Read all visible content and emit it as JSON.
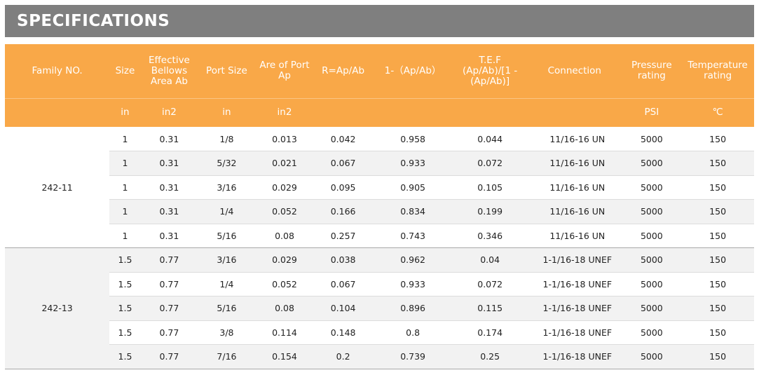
{
  "title": "SPECIFICATIONS",
  "headers": [
    "Family NO.",
    "Size",
    "Effective Bellows Area Ab",
    "Port Size",
    "Are of Port Ap",
    "R=Ap/Ab",
    "1-（Ap/Ab）",
    "T.E.F (Ap/Ab)/[1 -(Ap/Ab)]",
    "Connection",
    "Pressure rating",
    "Temperature rating"
  ],
  "units": [
    "",
    "in",
    "in2",
    "in",
    "in2",
    "",
    "",
    "",
    "",
    "PSI",
    "℃"
  ],
  "groups": [
    {
      "family": "242-11",
      "rows": [
        [
          "1",
          "0.31",
          "1/8",
          "0.013",
          "0.042",
          "0.958",
          "0.044",
          "11/16-16 UN",
          "5000",
          "150"
        ],
        [
          "1",
          "0.31",
          "5/32",
          "0.021",
          "0.067",
          "0.933",
          "0.072",
          "11/16-16 UN",
          "5000",
          "150"
        ],
        [
          "1",
          "0.31",
          "3/16",
          "0.029",
          "0.095",
          "0.905",
          "0.105",
          "11/16-16 UN",
          "5000",
          "150"
        ],
        [
          "1",
          "0.31",
          "1/4",
          "0.052",
          "0.166",
          "0.834",
          "0.199",
          "11/16-16 UN",
          "5000",
          "150"
        ],
        [
          "1",
          "0.31",
          "5/16",
          "0.08",
          "0.257",
          "0.743",
          "0.346",
          "11/16-16 UN",
          "5000",
          "150"
        ]
      ]
    },
    {
      "family": "242-13",
      "rows": [
        [
          "1.5",
          "0.77",
          "3/16",
          "0.029",
          "0.038",
          "0.962",
          "0.04",
          "1-1/16-18 UNEF",
          "5000",
          "150"
        ],
        [
          "1.5",
          "0.77",
          "1/4",
          "0.052",
          "0.067",
          "0.933",
          "0.072",
          "1-1/16-18 UNEF",
          "5000",
          "150"
        ],
        [
          "1.5",
          "0.77",
          "5/16",
          "0.08",
          "0.104",
          "0.896",
          "0.115",
          "1-1/16-18 UNEF",
          "5000",
          "150"
        ],
        [
          "1.5",
          "0.77",
          "3/8",
          "0.114",
          "0.148",
          "0.8",
          "0.174",
          "1-1/16-18 UNEF",
          "5000",
          "150"
        ],
        [
          "1.5",
          "0.77",
          "7/16",
          "0.154",
          "0.2",
          "0.739",
          "0.25",
          "1-1/16-18 UNEF",
          "5000",
          "150"
        ]
      ]
    }
  ],
  "colors": {
    "title_bg": "#7f7f7f",
    "header_bg": "#f9a848",
    "row_shade": "#f2f2f2"
  }
}
